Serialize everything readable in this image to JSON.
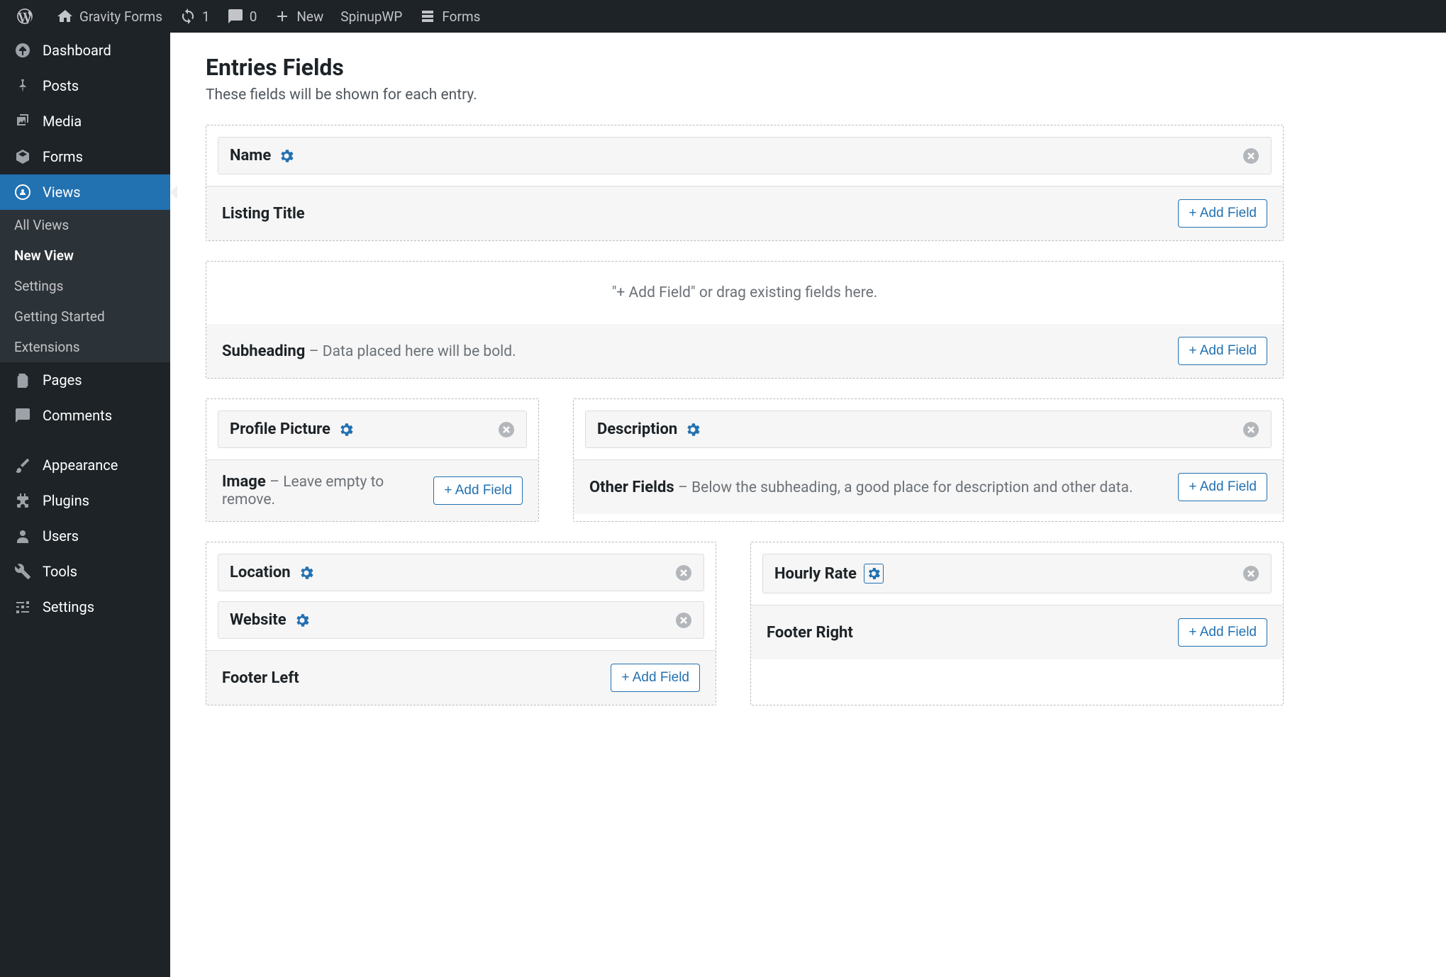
{
  "toolbar": {
    "site_name": "Gravity Forms",
    "updates": "1",
    "comments": "0",
    "new_label": "New",
    "spinup": "SpinupWP",
    "forms": "Forms"
  },
  "sidebar": {
    "dashboard": "Dashboard",
    "posts": "Posts",
    "media": "Media",
    "forms": "Forms",
    "views": "Views",
    "views_sub": {
      "all": "All Views",
      "new": "New View",
      "settings": "Settings",
      "getting_started": "Getting Started",
      "extensions": "Extensions"
    },
    "pages": "Pages",
    "comments": "Comments",
    "appearance": "Appearance",
    "plugins": "Plugins",
    "users": "Users",
    "tools": "Tools",
    "settings": "Settings"
  },
  "page": {
    "title": "Entries Fields",
    "subtitle": "These fields will be shown for each entry.",
    "add_field": "+ Add Field",
    "drop_hint": "\"+ Add Field\" or drag existing fields here."
  },
  "zones": {
    "listing_title": {
      "label": "Listing Title",
      "fields": [
        "Name"
      ]
    },
    "subheading": {
      "label": "Subheading",
      "desc": "Data placed here will be bold.",
      "fields": []
    },
    "image": {
      "label": "Image",
      "desc": "Leave empty to remove.",
      "fields": [
        "Profile Picture"
      ]
    },
    "other": {
      "label": "Other Fields",
      "desc": "Below the subheading, a good place for description and other data.",
      "fields": [
        "Description"
      ]
    },
    "footer_left": {
      "label": "Footer Left",
      "fields": [
        "Location",
        "Website"
      ]
    },
    "footer_right": {
      "label": "Footer Right",
      "fields": [
        "Hourly Rate"
      ]
    }
  }
}
